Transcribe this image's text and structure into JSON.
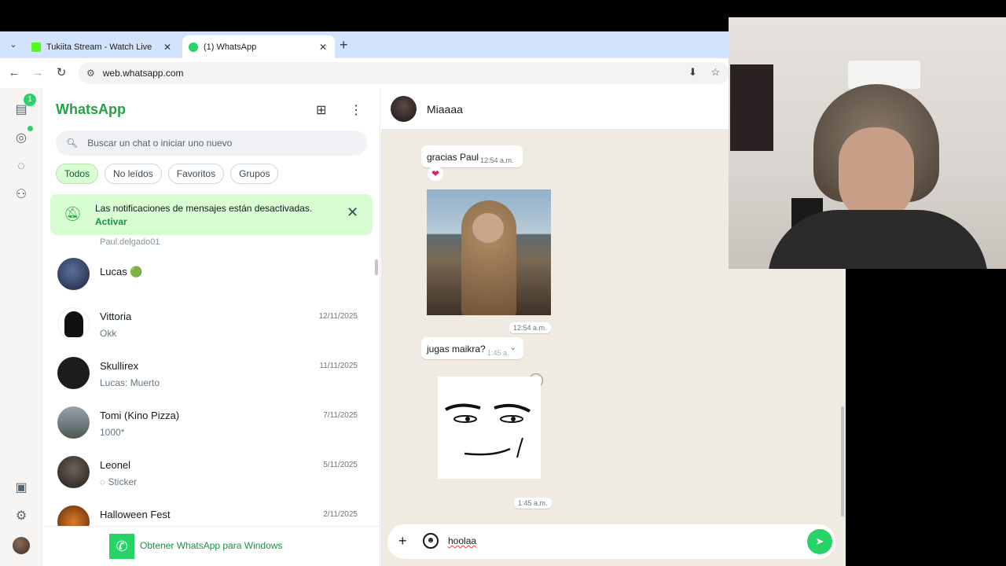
{
  "browser": {
    "tabs": [
      {
        "title": "Tukiita Stream - Watch Live",
        "favicon_color": "#53fc18",
        "close": "✕"
      },
      {
        "title": "(1) WhatsApp",
        "favicon_color": "#25d366",
        "close": "✕"
      }
    ],
    "new_tab": "+",
    "url": "web.whatsapp.com"
  },
  "rail": {
    "chats_badge": "1"
  },
  "sidebar": {
    "title": "WhatsApp",
    "search_placeholder": "Buscar un chat o iniciar uno nuevo",
    "filters": [
      "Todos",
      "No leídos",
      "Favoritos",
      "Grupos"
    ],
    "notice": {
      "message": "Las notificaciones de mensajes están desactivadas.",
      "action": "Activar"
    },
    "partial_preview": "Paul.delgado01",
    "chats": [
      {
        "name": "Lucas 🟢",
        "preview": "",
        "time": "",
        "avatar_color": "#2b3a5a"
      },
      {
        "name": "Vittoria",
        "preview": "Okk",
        "time": "12/11/2025",
        "avatar_color": "#111111"
      },
      {
        "name": "Skullirex",
        "preview": "Lucas: Muerto",
        "time": "11/11/2025",
        "avatar_color": "#1c1c1c"
      },
      {
        "name": "Tomi (Kino Pizza)",
        "preview": "1000*",
        "time": "7/11/2025",
        "avatar_color": "#6f7a7f"
      },
      {
        "name": "Leonel",
        "preview": "Sticker",
        "time": "5/11/2025",
        "avatar_color": "#3a3530"
      },
      {
        "name": "Halloween Fest",
        "preview": "",
        "time": "2/11/2025",
        "avatar_color": "#c2571a"
      }
    ],
    "get_windows": "Obtener WhatsApp para Windows"
  },
  "conversation": {
    "contact": "Miaaaa",
    "messages": [
      {
        "text": "gracias Paul",
        "time": "12:54 a.m.",
        "reaction": "❤"
      },
      {
        "image_time": "12:54 a.m."
      },
      {
        "text": "jugas maikra?",
        "time": "1:45 a."
      },
      {
        "sticker_time": "1:45 a.m."
      }
    ],
    "composer_text": "hoolaa"
  }
}
